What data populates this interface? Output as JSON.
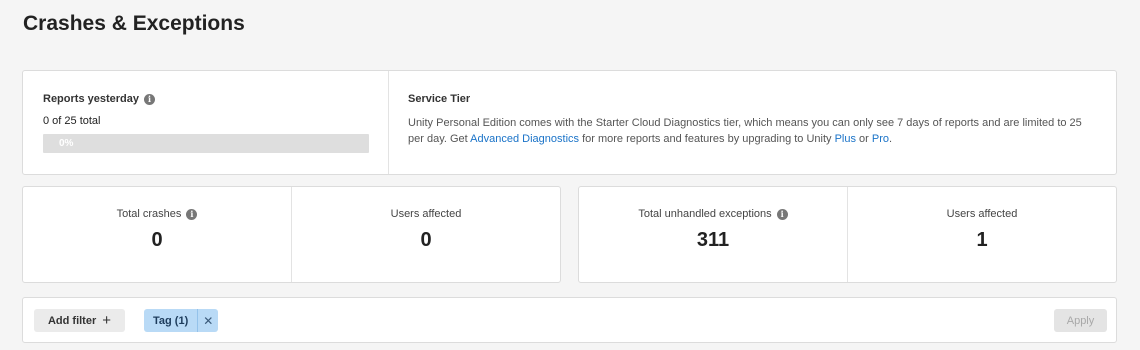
{
  "page": {
    "title": "Crashes & Exceptions"
  },
  "reports": {
    "label": "Reports yesterday",
    "info_icon": "info-icon",
    "count_text": "0 of 25 total",
    "progress_percent": 0,
    "progress_text": "0%"
  },
  "service_tier": {
    "title": "Service Tier",
    "desc_part1": "Unity Personal Edition comes with the Starter Cloud Diagnostics tier, which means you can only see 7 days of reports and are limited to 25 per day. Get ",
    "advanced_link": "Advanced Diagnostics",
    "desc_part2": " for more reports and features by upgrading to Unity ",
    "plus_link": "Plus",
    "desc_part3": " or ",
    "pro_link": "Pro",
    "desc_part4": "."
  },
  "crashes": {
    "total_label": "Total crashes",
    "total_value": "0",
    "users_label": "Users affected",
    "users_value": "0"
  },
  "exceptions": {
    "total_label": "Total unhandled exceptions",
    "total_value": "311",
    "users_label": "Users affected",
    "users_value": "1"
  },
  "filters": {
    "add_filter_label": "Add filter",
    "add_icon": "plus-icon",
    "tag_label": "Tag (1)",
    "tag_close_icon": "close-icon",
    "apply_label": "Apply"
  },
  "colors": {
    "link": "#1a73c8",
    "tag_bg": "#b9daf6",
    "background": "#f5f5f5"
  }
}
